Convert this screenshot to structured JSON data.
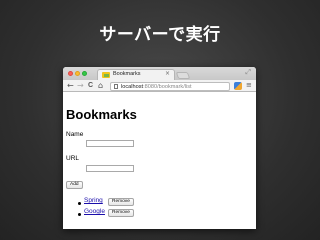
{
  "slide": {
    "title": "サーバーで実行"
  },
  "browser": {
    "tab": {
      "title": "Bookmarks",
      "close_glyph": "×"
    },
    "toolbar": {
      "back_glyph": "←",
      "forward_glyph": "→",
      "reload_glyph": "C",
      "home_glyph": "⌂",
      "menu_glyph": "≡",
      "fullscreen_glyph": "⤢"
    },
    "address": {
      "host": "localhost",
      "path": ":8080/bookmark/list"
    }
  },
  "page": {
    "heading": "Bookmarks",
    "form": {
      "name_label": "Name",
      "name_value": "",
      "url_label": "URL",
      "url_value": "",
      "add_button": "Add"
    },
    "bookmarks": [
      {
        "title": "Spring",
        "remove_label": "Remove"
      },
      {
        "title": "Google",
        "remove_label": "Remove"
      }
    ]
  }
}
